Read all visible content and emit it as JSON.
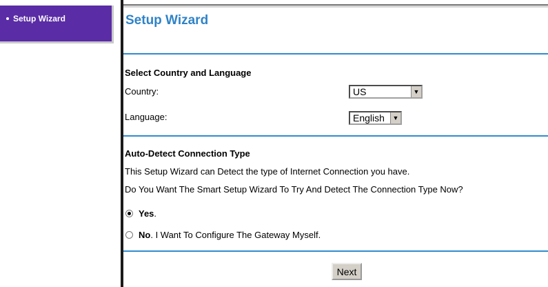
{
  "nav": {
    "items": [
      {
        "label": "Setup Wizard"
      }
    ]
  },
  "main": {
    "title": "Setup Wizard",
    "country_language": {
      "heading": "Select Country and Language",
      "country_label": "Country:",
      "country_value": "US",
      "language_label": "Language:",
      "language_value": "English"
    },
    "auto_detect": {
      "heading": "Auto-Detect Connection Type",
      "line1": "This Setup Wizard can Detect the type of Internet Connection you have.",
      "line2": "Do You Want The Smart Setup Wizard To Try And Detect The Connection Type Now?",
      "options": [
        {
          "bold": "Yes",
          "rest": ".",
          "selected": true
        },
        {
          "bold": "No",
          "rest": ". I Want To Configure The Gateway Myself.",
          "selected": false
        }
      ]
    },
    "next_label": "Next"
  },
  "colors": {
    "nav_bg": "#5a2ca6",
    "title_blue": "#2f83c7",
    "rule_blue": "#2e8ccf"
  }
}
